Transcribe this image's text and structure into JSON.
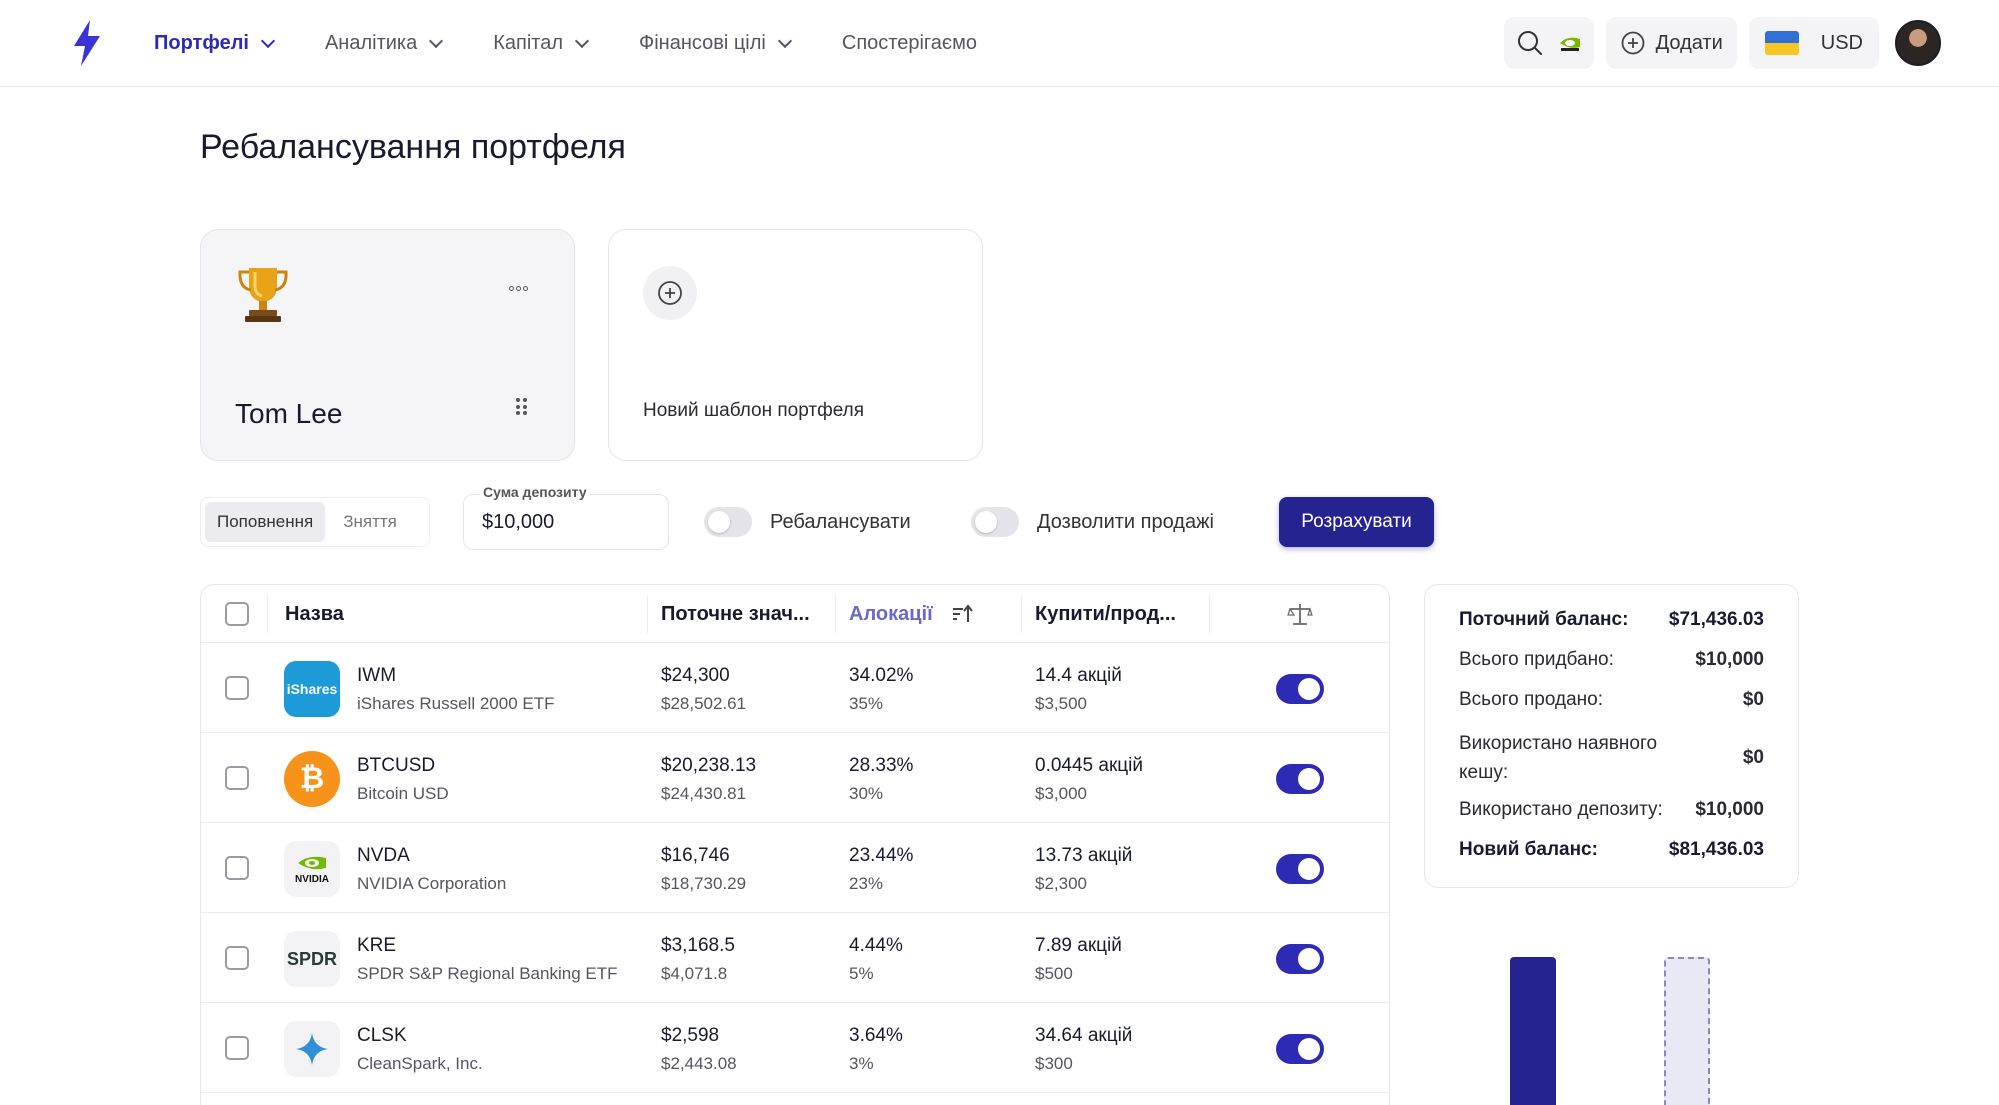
{
  "nav": {
    "items": [
      {
        "label": "Портфелі",
        "active": true,
        "dropdown": true
      },
      {
        "label": "Аналітика",
        "active": false,
        "dropdown": true
      },
      {
        "label": "Капітал",
        "active": false,
        "dropdown": true
      },
      {
        "label": "Фінансові цілі",
        "active": false,
        "dropdown": true
      },
      {
        "label": "Спостерігаємо",
        "active": false,
        "dropdown": false
      }
    ],
    "add_label": "Додати",
    "currency": "USD"
  },
  "page_title": "Ребалансування портфеля",
  "templates": {
    "selected_name": "Tom Lee",
    "new_label": "Новий шаблон портфеля"
  },
  "controls": {
    "seg_deposit": "Поповнення",
    "seg_withdraw": "Зняття",
    "deposit_label": "Сума депозиту",
    "deposit_value": "$10,000",
    "toggle_rebalance": "Ребалансувати",
    "toggle_allow_sales": "Дозволити продажі",
    "calculate": "Розрахувати"
  },
  "table": {
    "headers": {
      "name": "Назва",
      "current": "Поточне знач...",
      "alloc": "Алокації",
      "buy_sell": "Купити/прод..."
    },
    "rows": [
      {
        "ticker": "IWM",
        "name": "iShares Russell 2000 ETF",
        "cur": "$24,300",
        "target": "$28,502.61",
        "alloc_cur": "34.02%",
        "alloc_target": "35%",
        "shares": "14.4 акцій",
        "amount": "$3,500",
        "logo_text": "iShares"
      },
      {
        "ticker": "BTCUSD",
        "name": "Bitcoin USD",
        "cur": "$20,238.13",
        "target": "$24,430.81",
        "alloc_cur": "28.33%",
        "alloc_target": "30%",
        "shares": "0.0445 акцій",
        "amount": "$3,000",
        "logo_text": "₿"
      },
      {
        "ticker": "NVDA",
        "name": "NVIDIA Corporation",
        "cur": "$16,746",
        "target": "$18,730.29",
        "alloc_cur": "23.44%",
        "alloc_target": "23%",
        "shares": "13.73 акцій",
        "amount": "$2,300",
        "logo_text": "NVIDIA"
      },
      {
        "ticker": "KRE",
        "name": "SPDR S&P Regional Banking ETF",
        "cur": "$3,168.5",
        "target": "$4,071.8",
        "alloc_cur": "4.44%",
        "alloc_target": "5%",
        "shares": "7.89 акцій",
        "amount": "$500",
        "logo_text": "SPDR"
      },
      {
        "ticker": "CLSK",
        "name": "CleanSpark, Inc.",
        "cur": "$2,598",
        "target": "$2,443.08",
        "alloc_cur": "3.64%",
        "alloc_target": "3%",
        "shares": "34.64 акцій",
        "amount": "$300",
        "logo_text": ""
      }
    ]
  },
  "summary": {
    "current_balance_label": "Поточний баланс:",
    "current_balance": "$71,436.03",
    "bought_label": "Всього придбано:",
    "bought": "$10,000",
    "sold_label": "Всього продано:",
    "sold": "$0",
    "cash_used_label_1": "Використано наявного",
    "cash_used_label_2": "кешу:",
    "cash_used": "$0",
    "deposit_used_label": "Використано депозиту:",
    "deposit_used": "$10,000",
    "new_balance_label": "Новий баланс:",
    "new_balance": "$81,436.03"
  },
  "colors": {
    "accent": "#2d2bb6",
    "button": "#25238f"
  }
}
